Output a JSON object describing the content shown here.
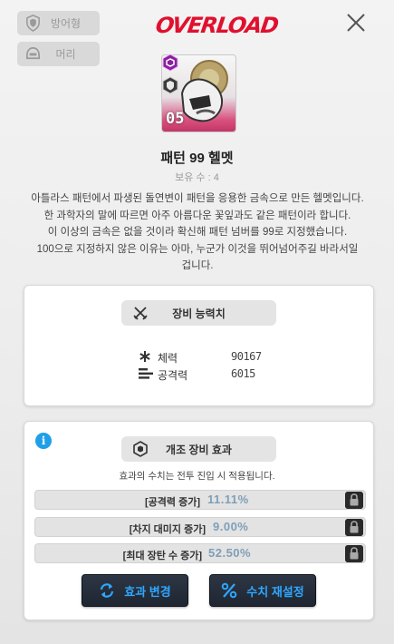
{
  "tags": {
    "defense_label": "방어형",
    "head_label": "머리"
  },
  "logo": "OVERLOAD",
  "item": {
    "number": "05",
    "name": "패턴 99 헬멧",
    "owned": "보유 수 : 4",
    "description": [
      "아틀라스 패턴에서 파생된 돌연변이 패턴을 응용한 금속으로 만든 헬멧입니다.",
      "한 과학자의 말에 따르면 아주 아름다운 꽃잎과도 같은 패턴이라 합니다.",
      "이 이상의 금속은 없을 것이라 확신해 패턴 넘버를 99로 지정했습니다.",
      "100으로 지정하지 않은 이유는 아마, 누군가 이것을 뛰어넘어주길 바라서일",
      "겁니다."
    ]
  },
  "stats_section": {
    "header": "장비 능력치",
    "stats": [
      {
        "label": "체력",
        "value": "90167",
        "icon": "asterisk-icon"
      },
      {
        "label": "공격력",
        "value": "6015",
        "icon": "attack-bars-icon"
      }
    ]
  },
  "overload_section": {
    "header": "개조 장비 효과",
    "note": "효과의 수치는 전투 진입 시 적용됩니다.",
    "effects": [
      {
        "label": "[공격력 증가]",
        "value": "11.11%"
      },
      {
        "label": "[차지 대미지 증가]",
        "value": "9.00%"
      },
      {
        "label": "[최대 장탄 수 증가]",
        "value": "52.50%"
      }
    ]
  },
  "buttons": {
    "change_effect": "효과 변경",
    "reset_values": "수치 재설정"
  },
  "colors": {
    "accent_blue": "#2fa7ff",
    "logo_red": "#e0102e",
    "value_blue": "#7f9eb7"
  }
}
